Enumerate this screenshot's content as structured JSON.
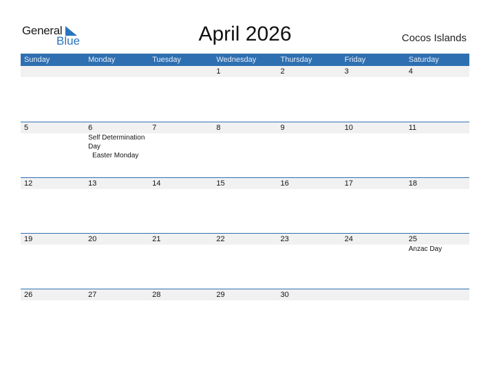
{
  "logo": {
    "word1": "General",
    "word2": "Blue",
    "accent_color": "#2a74bd"
  },
  "header": {
    "title": "April 2026",
    "country": "Cocos Islands"
  },
  "colors": {
    "header_bar": "#2e6fb1",
    "date_strip": "#f1f1f1"
  },
  "weekdays": [
    "Sunday",
    "Monday",
    "Tuesday",
    "Wednesday",
    "Thursday",
    "Friday",
    "Saturday"
  ],
  "weeks": [
    {
      "days": [
        "",
        "",
        "",
        "1",
        "2",
        "3",
        "4"
      ],
      "events": [
        [],
        [],
        [],
        [],
        [],
        [],
        []
      ]
    },
    {
      "days": [
        "5",
        "6",
        "7",
        "8",
        "9",
        "10",
        "11"
      ],
      "events": [
        [],
        [
          "Self Determination Day",
          "Easter Monday"
        ],
        [],
        [],
        [],
        [],
        []
      ]
    },
    {
      "days": [
        "12",
        "13",
        "14",
        "15",
        "16",
        "17",
        "18"
      ],
      "events": [
        [],
        [],
        [],
        [],
        [],
        [],
        []
      ]
    },
    {
      "days": [
        "19",
        "20",
        "21",
        "22",
        "23",
        "24",
        "25"
      ],
      "events": [
        [],
        [],
        [],
        [],
        [],
        [],
        [
          "Anzac Day"
        ]
      ]
    },
    {
      "days": [
        "26",
        "27",
        "28",
        "29",
        "30",
        "",
        ""
      ],
      "events": [
        [],
        [],
        [],
        [],
        [],
        [],
        []
      ]
    }
  ]
}
